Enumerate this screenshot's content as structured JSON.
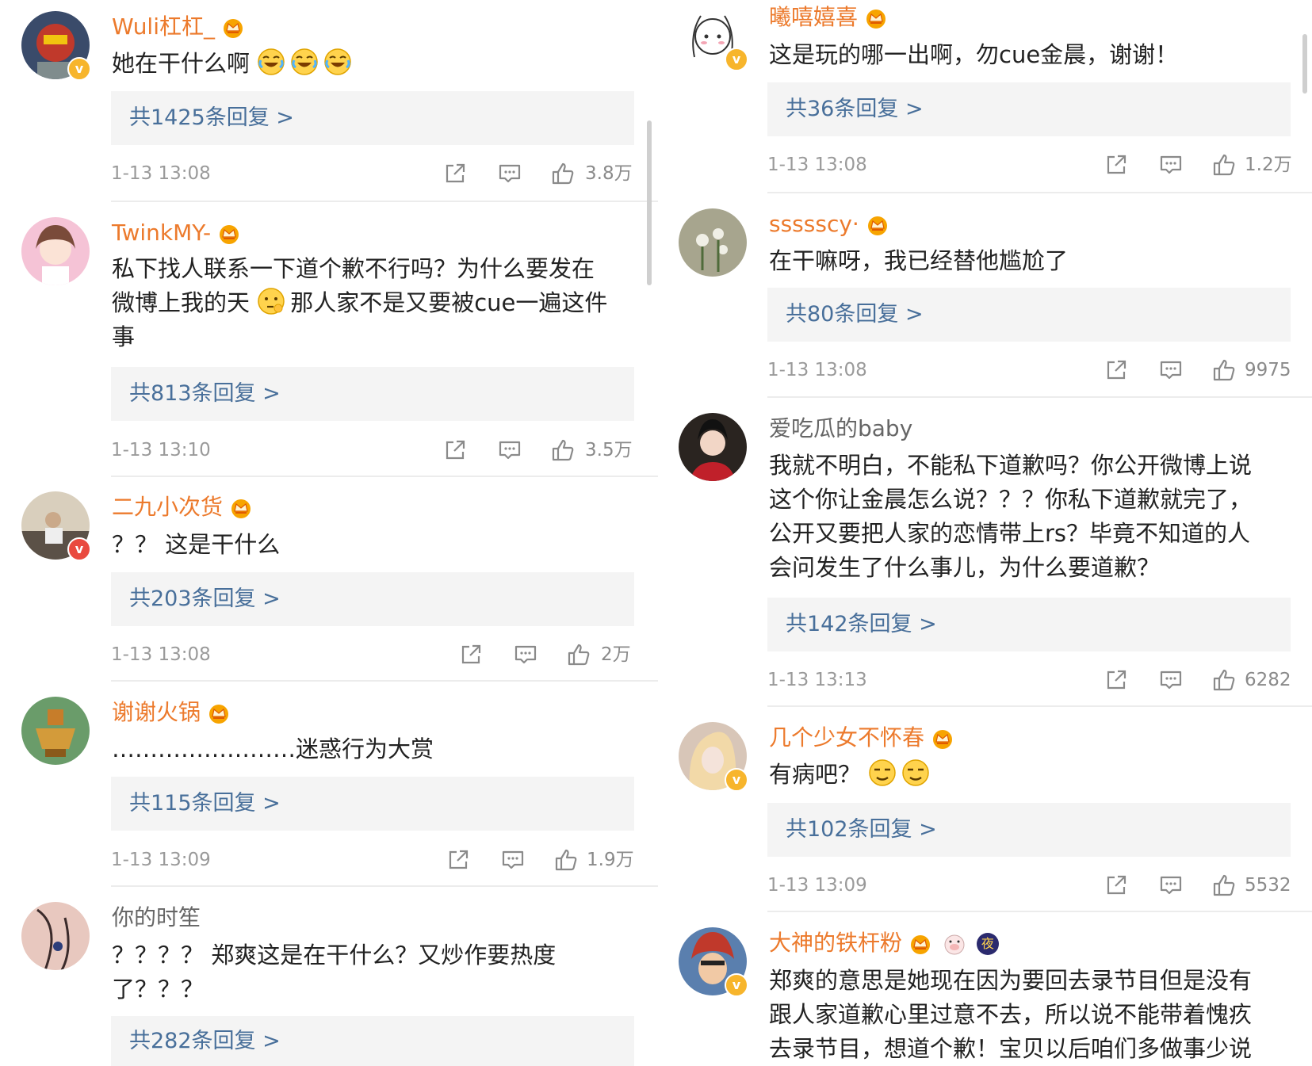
{
  "left_comments": [
    {
      "username": "Wuli杠杠_",
      "text_lines": [
        "她在干什么啊"
      ],
      "emojis": "laugh-cry x3",
      "replies": "共1425条回复 >",
      "time": "1-13 13:08",
      "likes": "3.8万"
    },
    {
      "username": "TwinkMY-",
      "text_lines": [
        "私下找人联系一下道个歉不行吗？为什么要发在",
        "微博上我的天",
        "那人家不是又要被cue一遍这件",
        "事"
      ],
      "replies": "共813条回复 >",
      "time": "1-13 13:10",
      "likes": "3.5万"
    },
    {
      "username": "二九小次货",
      "text_lines": [
        "？？ 这是干什么"
      ],
      "replies": "共203条回复 >",
      "time": "1-13 13:08",
      "likes": "2万"
    },
    {
      "username": "谢谢火锅",
      "text_lines": [
        "……………………迷惑行为大赏"
      ],
      "replies": "共115条回复 >",
      "time": "1-13 13:09",
      "likes": "1.9万"
    },
    {
      "username": "你的时笙",
      "text_lines": [
        "？？？？ 郑爽这是在干什么？又炒作要热度",
        "了？？？"
      ],
      "replies": "共282条回复 >"
    }
  ],
  "right_comments": [
    {
      "username": "曦嘻嬉喜",
      "text_lines": [
        "这是玩的哪一出啊，勿cue金晨，谢谢！"
      ],
      "replies": "共36条回复 >",
      "time": "1-13 13:08",
      "likes": "1.2万"
    },
    {
      "username": "ssssscy·",
      "text_lines": [
        "在干嘛呀，我已经替他尴尬了"
      ],
      "replies": "共80条回复 >",
      "time": "1-13 13:08",
      "likes": "9975"
    },
    {
      "username": "爱吃瓜的baby",
      "text_lines": [
        "我就不明白，不能私下道歉吗？你公开微博上说",
        "这个你让金晨怎么说？？？你私下道歉就完了，",
        "公开又要把人家的恋情带上rs？毕竟不知道的人",
        "会问发生了什么事儿，为什么要道歉？"
      ],
      "replies": "共142条回复 >",
      "time": "1-13 13:13",
      "likes": "6282"
    },
    {
      "username": "几个少女不怀春",
      "text_lines": [
        "有病吧？"
      ],
      "emojis": "smug x2",
      "replies": "共102条回复 >",
      "time": "1-13 13:09",
      "likes": "5532"
    },
    {
      "username": "大神的铁杆粉",
      "text_lines": [
        "郑爽的意思是她现在因为要回去录节目但是没有",
        "跟人家道歉心里过意不去，所以说不能带着愧疚",
        "去录节目，想道个歉！宝贝以后咱们多做事少说"
      ],
      "badge_text": "夜"
    }
  ],
  "badges": {
    "verified": "v"
  },
  "icons": {
    "share": "share-icon",
    "comment": "comment-icon",
    "like": "like-icon",
    "crown": "crown-badge-icon"
  },
  "colors": {
    "username": "#ec7a2c",
    "reply_link": "#486f9a",
    "reply_bg": "#f4f4f4",
    "meta": "#9a9a9a",
    "badge_gold": "#f7b52c",
    "badge_red": "#e94a3f"
  }
}
